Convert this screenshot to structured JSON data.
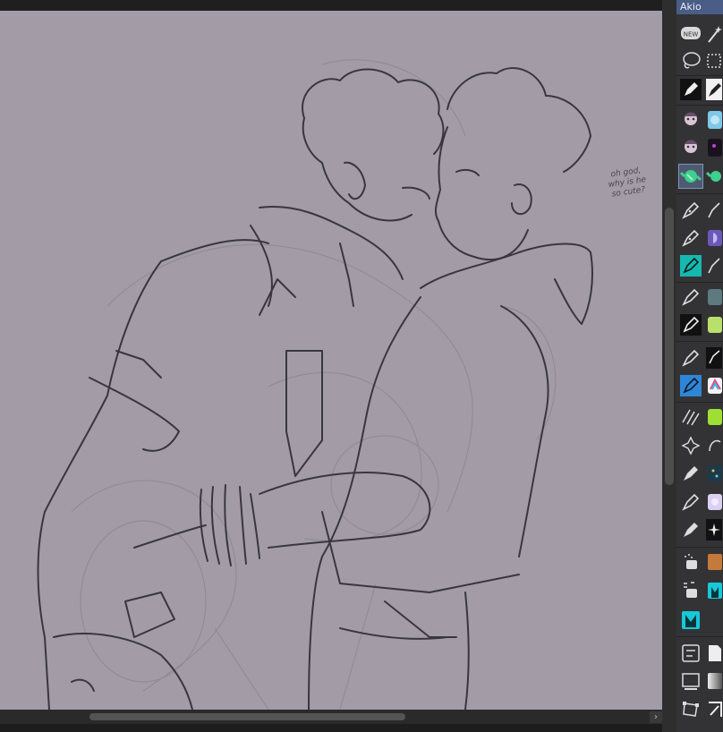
{
  "canvas": {
    "thought_bubble": [
      "oh god,",
      "why is he",
      "so cute?"
    ]
  },
  "scrollbar": {
    "right_arrow": "›"
  },
  "panel": {
    "title": "Akio",
    "new_badge": "NEW"
  },
  "colors": {
    "canvas_bg": "#a39ca6",
    "panel_bg": "#333336",
    "panel_header": "#4a5d86",
    "selected_tile": "#4d5a70"
  }
}
